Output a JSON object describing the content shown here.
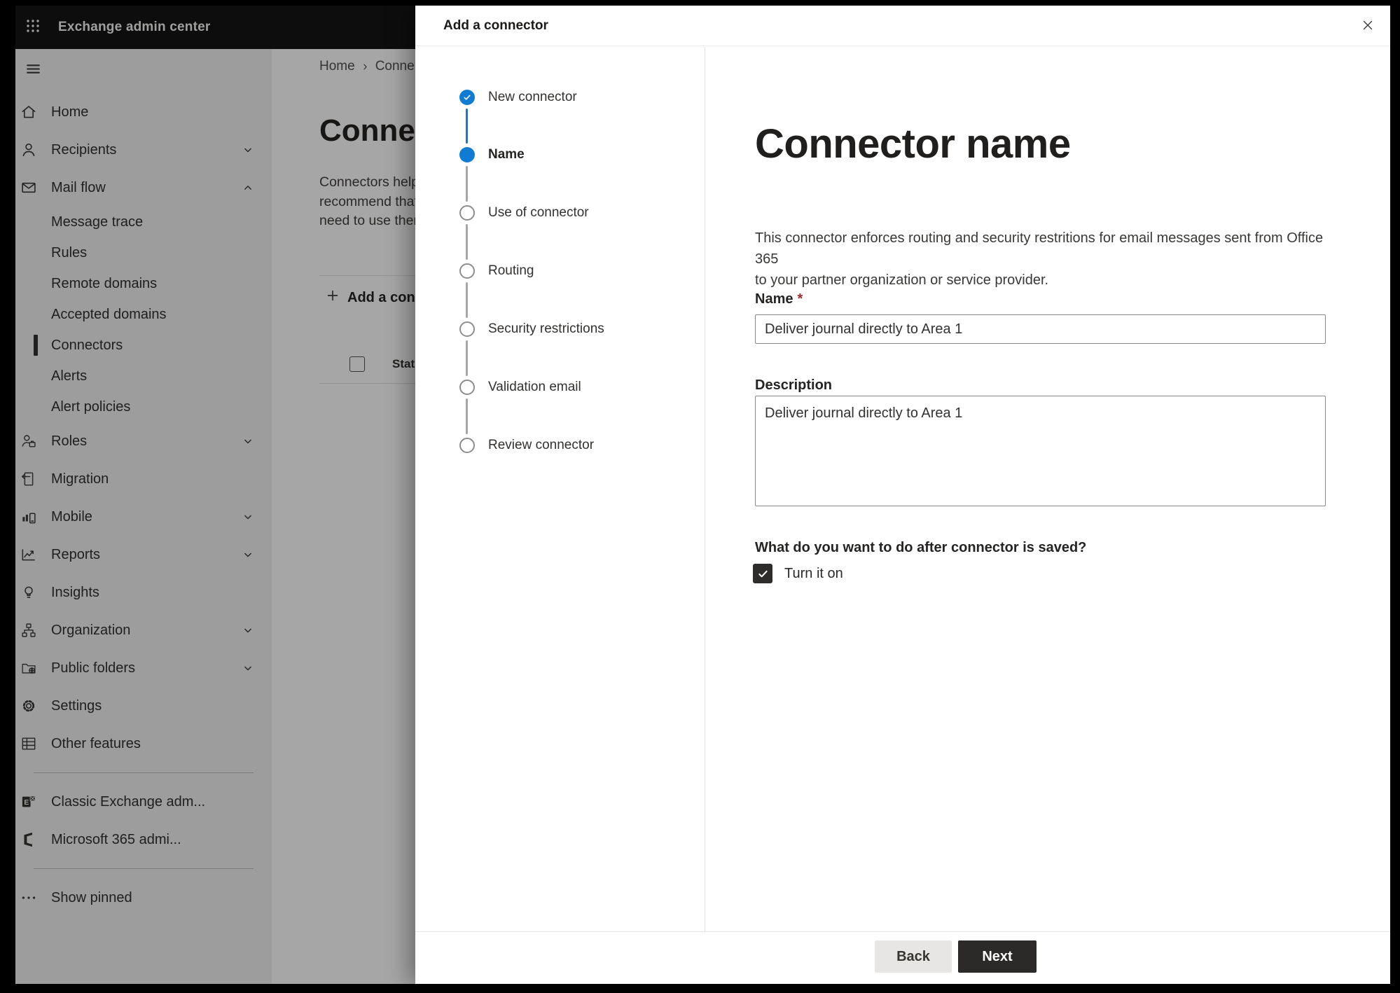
{
  "colors": {
    "accent": "#0078d4",
    "primary_button": "#2b2a28",
    "required": "#a4262c",
    "selected_indicator": "#35322f"
  },
  "topbar": {
    "title": "Exchange admin center",
    "waffle_icon": "app-launcher-icon"
  },
  "sidebar": {
    "hamburger_icon": "hamburger-menu-icon",
    "items": [
      {
        "label": "Home",
        "icon": "home-icon",
        "type": "top"
      },
      {
        "label": "Recipients",
        "icon": "recipients-icon",
        "type": "top",
        "chevron": "down"
      },
      {
        "label": "Mail flow",
        "icon": "mail-flow-icon",
        "type": "top",
        "chevron": "up"
      },
      {
        "label": "Message trace",
        "type": "sub"
      },
      {
        "label": "Rules",
        "type": "sub"
      },
      {
        "label": "Remote domains",
        "type": "sub"
      },
      {
        "label": "Accepted domains",
        "type": "sub"
      },
      {
        "label": "Connectors",
        "type": "sub",
        "selected": true
      },
      {
        "label": "Alerts",
        "type": "sub"
      },
      {
        "label": "Alert policies",
        "type": "sub"
      },
      {
        "label": "Roles",
        "icon": "roles-icon",
        "type": "top",
        "chevron": "down"
      },
      {
        "label": "Migration",
        "icon": "migration-icon",
        "type": "top"
      },
      {
        "label": "Mobile",
        "icon": "mobile-icon",
        "type": "top",
        "chevron": "down"
      },
      {
        "label": "Reports",
        "icon": "reports-icon",
        "type": "top",
        "chevron": "down"
      },
      {
        "label": "Insights",
        "icon": "insights-icon",
        "type": "top"
      },
      {
        "label": "Organization",
        "icon": "organization-icon",
        "type": "top",
        "chevron": "down"
      },
      {
        "label": "Public folders",
        "icon": "public-folders-icon",
        "type": "top",
        "chevron": "down"
      },
      {
        "label": "Settings",
        "icon": "settings-icon",
        "type": "top"
      },
      {
        "label": "Other features",
        "icon": "other-features-icon",
        "type": "top"
      },
      {
        "type": "divider"
      },
      {
        "label": "Classic Exchange adm...",
        "icon": "classic-exchange-icon",
        "type": "top"
      },
      {
        "label": "Microsoft 365 admi...",
        "icon": "microsoft-365-icon",
        "type": "top"
      },
      {
        "type": "divider"
      },
      {
        "label": "Show pinned",
        "icon": "ellipsis-icon",
        "type": "top"
      }
    ]
  },
  "background_page": {
    "breadcrumb": [
      "Home",
      "Conne"
    ],
    "heading": "Connect",
    "intro_lines": [
      "Connectors help",
      "recommend that",
      "need to use ther"
    ],
    "add_button_label": "Add a conn",
    "table": {
      "status_header": "Status"
    }
  },
  "modal": {
    "title": "Add a connector",
    "close_icon": "close-icon",
    "steps": [
      {
        "label": "New connector",
        "state": "completed"
      },
      {
        "label": "Name",
        "state": "current"
      },
      {
        "label": "Use of connector",
        "state": "upcoming"
      },
      {
        "label": "Routing",
        "state": "upcoming"
      },
      {
        "label": "Security restrictions",
        "state": "upcoming"
      },
      {
        "label": "Validation email",
        "state": "upcoming"
      },
      {
        "label": "Review connector",
        "state": "upcoming"
      }
    ],
    "content": {
      "heading": "Connector name",
      "description": "This connector enforces routing and security restritions for email messages sent from Office 365\nto your partner organization or service provider.",
      "name_label": "Name",
      "required_marker": "*",
      "name_value": "Deliver journal directly to Area 1",
      "description_label": "Description",
      "description_value": "Deliver journal directly to Area 1",
      "after_save_question": "What do you want to do after connector is saved?",
      "turn_on_label": "Turn it on",
      "turn_on_checked": true
    },
    "footer": {
      "back_label": "Back",
      "next_label": "Next"
    }
  }
}
